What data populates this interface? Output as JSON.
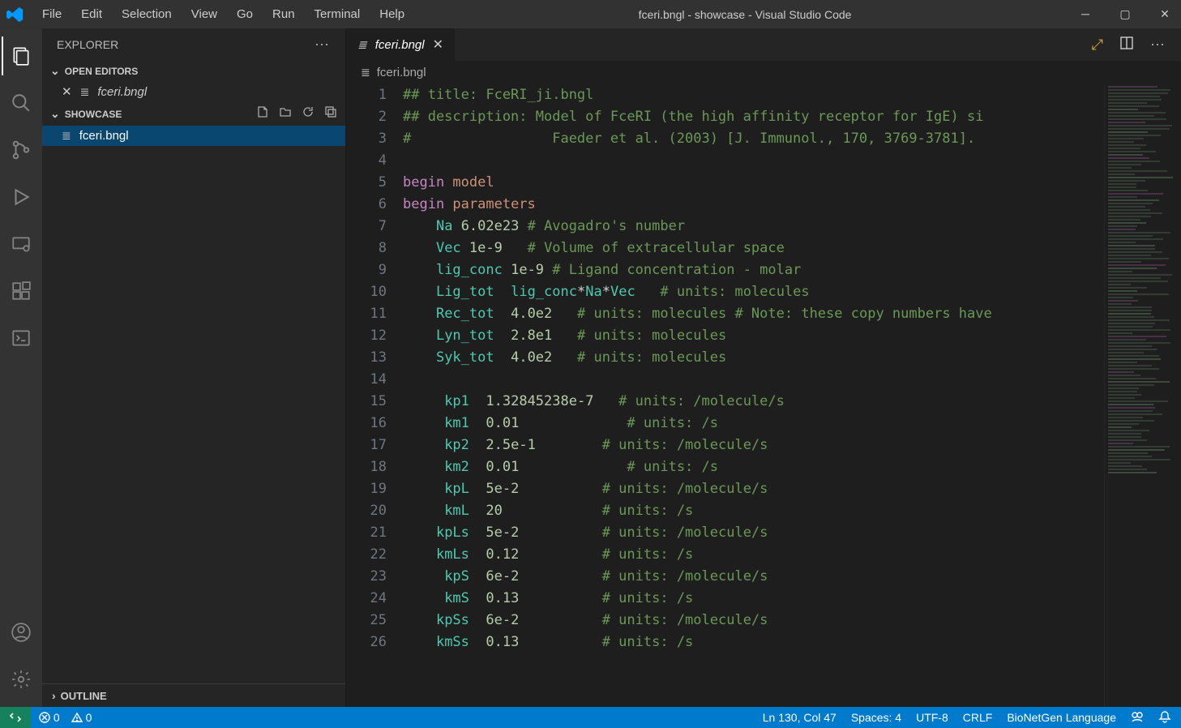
{
  "window": {
    "title": "fceri.bngl - showcase - Visual Studio Code"
  },
  "menubar": [
    "File",
    "Edit",
    "Selection",
    "View",
    "Go",
    "Run",
    "Terminal",
    "Help"
  ],
  "sidebar": {
    "title": "EXPLORER",
    "open_editors": {
      "title": "OPEN EDITORS",
      "items": [
        "fceri.bngl"
      ]
    },
    "folder": {
      "title": "SHOWCASE",
      "items": [
        "fceri.bngl"
      ]
    },
    "outline": "OUTLINE"
  },
  "tab": {
    "name": "fceri.bngl"
  },
  "breadcrumb": "fceri.bngl",
  "code": {
    "lines": [
      {
        "n": 1,
        "tokens": [
          [
            "## title: FceRI_ji.bngl",
            "comment"
          ]
        ]
      },
      {
        "n": 2,
        "tokens": [
          [
            "## description: Model of FceRI (the high affinity receptor for IgE) si",
            "comment"
          ]
        ]
      },
      {
        "n": 3,
        "tokens": [
          [
            "#                 Faeder et al. (2003) [J. Immunol., 170, 3769-3781].",
            "comment"
          ]
        ]
      },
      {
        "n": 4,
        "tokens": [
          [
            "",
            "plain"
          ]
        ]
      },
      {
        "n": 5,
        "tokens": [
          [
            "begin ",
            "keyword"
          ],
          [
            "model",
            "type"
          ]
        ]
      },
      {
        "n": 6,
        "tokens": [
          [
            "begin ",
            "keyword"
          ],
          [
            "parameters",
            "type"
          ]
        ]
      },
      {
        "n": 7,
        "tokens": [
          [
            "    ",
            "plain"
          ],
          [
            "Na",
            "ident"
          ],
          [
            " ",
            "plain"
          ],
          [
            "6.02e23",
            "number"
          ],
          [
            " ",
            "plain"
          ],
          [
            "# Avogadro's number",
            "comment"
          ]
        ]
      },
      {
        "n": 8,
        "tokens": [
          [
            "    ",
            "plain"
          ],
          [
            "Vec",
            "ident"
          ],
          [
            " ",
            "plain"
          ],
          [
            "1e-9",
            "number"
          ],
          [
            "   ",
            "plain"
          ],
          [
            "# Volume of extracellular space",
            "comment"
          ]
        ]
      },
      {
        "n": 9,
        "tokens": [
          [
            "    ",
            "plain"
          ],
          [
            "lig_conc",
            "ident"
          ],
          [
            " ",
            "plain"
          ],
          [
            "1e-9",
            "number"
          ],
          [
            " ",
            "plain"
          ],
          [
            "# Ligand concentration - molar",
            "comment"
          ]
        ]
      },
      {
        "n": 10,
        "tokens": [
          [
            "    ",
            "plain"
          ],
          [
            "Lig_tot",
            "ident"
          ],
          [
            "  ",
            "plain"
          ],
          [
            "lig_conc",
            "ident"
          ],
          [
            "*",
            "op"
          ],
          [
            "Na",
            "ident"
          ],
          [
            "*",
            "op"
          ],
          [
            "Vec",
            "ident"
          ],
          [
            "   ",
            "plain"
          ],
          [
            "# units: molecules",
            "comment"
          ]
        ]
      },
      {
        "n": 11,
        "tokens": [
          [
            "    ",
            "plain"
          ],
          [
            "Rec_tot",
            "ident"
          ],
          [
            "  ",
            "plain"
          ],
          [
            "4.0e2",
            "number"
          ],
          [
            "   ",
            "plain"
          ],
          [
            "# units: molecules # Note: these copy numbers have",
            "comment"
          ]
        ]
      },
      {
        "n": 12,
        "tokens": [
          [
            "    ",
            "plain"
          ],
          [
            "Lyn_tot",
            "ident"
          ],
          [
            "  ",
            "plain"
          ],
          [
            "2.8e1",
            "number"
          ],
          [
            "   ",
            "plain"
          ],
          [
            "# units: molecules",
            "comment"
          ]
        ]
      },
      {
        "n": 13,
        "tokens": [
          [
            "    ",
            "plain"
          ],
          [
            "Syk_tot",
            "ident"
          ],
          [
            "  ",
            "plain"
          ],
          [
            "4.0e2",
            "number"
          ],
          [
            "   ",
            "plain"
          ],
          [
            "# units: molecules",
            "comment"
          ]
        ]
      },
      {
        "n": 14,
        "tokens": [
          [
            "",
            "plain"
          ]
        ]
      },
      {
        "n": 15,
        "tokens": [
          [
            "     ",
            "plain"
          ],
          [
            "kp1",
            "ident"
          ],
          [
            "  ",
            "plain"
          ],
          [
            "1.32845238e-7",
            "number"
          ],
          [
            "   ",
            "plain"
          ],
          [
            "# units: /molecule/s",
            "comment"
          ]
        ]
      },
      {
        "n": 16,
        "tokens": [
          [
            "     ",
            "plain"
          ],
          [
            "km1",
            "ident"
          ],
          [
            "  ",
            "plain"
          ],
          [
            "0.01",
            "number"
          ],
          [
            "             ",
            "plain"
          ],
          [
            "# units: /s",
            "comment"
          ]
        ]
      },
      {
        "n": 17,
        "tokens": [
          [
            "     ",
            "plain"
          ],
          [
            "kp2",
            "ident"
          ],
          [
            "  ",
            "plain"
          ],
          [
            "2.5e-1",
            "number"
          ],
          [
            "        ",
            "plain"
          ],
          [
            "# units: /molecule/s",
            "comment"
          ]
        ]
      },
      {
        "n": 18,
        "tokens": [
          [
            "     ",
            "plain"
          ],
          [
            "km2",
            "ident"
          ],
          [
            "  ",
            "plain"
          ],
          [
            "0.01",
            "number"
          ],
          [
            "             ",
            "plain"
          ],
          [
            "# units: /s",
            "comment"
          ]
        ]
      },
      {
        "n": 19,
        "tokens": [
          [
            "     ",
            "plain"
          ],
          [
            "kpL",
            "ident"
          ],
          [
            "  ",
            "plain"
          ],
          [
            "5e-2",
            "number"
          ],
          [
            "          ",
            "plain"
          ],
          [
            "# units: /molecule/s",
            "comment"
          ]
        ]
      },
      {
        "n": 20,
        "tokens": [
          [
            "     ",
            "plain"
          ],
          [
            "kmL",
            "ident"
          ],
          [
            "  ",
            "plain"
          ],
          [
            "20",
            "number"
          ],
          [
            "            ",
            "plain"
          ],
          [
            "# units: /s",
            "comment"
          ]
        ]
      },
      {
        "n": 21,
        "tokens": [
          [
            "    ",
            "plain"
          ],
          [
            "kpLs",
            "ident"
          ],
          [
            "  ",
            "plain"
          ],
          [
            "5e-2",
            "number"
          ],
          [
            "          ",
            "plain"
          ],
          [
            "# units: /molecule/s",
            "comment"
          ]
        ]
      },
      {
        "n": 22,
        "tokens": [
          [
            "    ",
            "plain"
          ],
          [
            "kmLs",
            "ident"
          ],
          [
            "  ",
            "plain"
          ],
          [
            "0.12",
            "number"
          ],
          [
            "          ",
            "plain"
          ],
          [
            "# units: /s",
            "comment"
          ]
        ]
      },
      {
        "n": 23,
        "tokens": [
          [
            "     ",
            "plain"
          ],
          [
            "kpS",
            "ident"
          ],
          [
            "  ",
            "plain"
          ],
          [
            "6e-2",
            "number"
          ],
          [
            "          ",
            "plain"
          ],
          [
            "# units: /molecule/s",
            "comment"
          ]
        ]
      },
      {
        "n": 24,
        "tokens": [
          [
            "     ",
            "plain"
          ],
          [
            "kmS",
            "ident"
          ],
          [
            "  ",
            "plain"
          ],
          [
            "0.13",
            "number"
          ],
          [
            "          ",
            "plain"
          ],
          [
            "# units: /s",
            "comment"
          ]
        ]
      },
      {
        "n": 25,
        "tokens": [
          [
            "    ",
            "plain"
          ],
          [
            "kpSs",
            "ident"
          ],
          [
            "  ",
            "plain"
          ],
          [
            "6e-2",
            "number"
          ],
          [
            "          ",
            "plain"
          ],
          [
            "# units: /molecule/s",
            "comment"
          ]
        ]
      },
      {
        "n": 26,
        "tokens": [
          [
            "    ",
            "plain"
          ],
          [
            "kmSs",
            "ident"
          ],
          [
            "  ",
            "plain"
          ],
          [
            "0.13",
            "number"
          ],
          [
            "          ",
            "plain"
          ],
          [
            "# units: /s",
            "comment"
          ]
        ]
      }
    ]
  },
  "status": {
    "errors": "0",
    "warnings": "0",
    "position": "Ln 130, Col 47",
    "spaces": "Spaces: 4",
    "encoding": "UTF-8",
    "eol": "CRLF",
    "language": "BioNetGen Language"
  }
}
